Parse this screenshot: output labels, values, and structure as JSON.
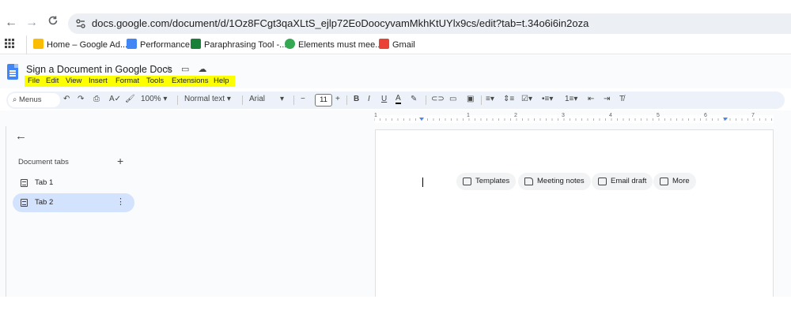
{
  "browser": {
    "url": "docs.google.com/document/d/1Oz8FCgt3qaXLtS_ejlp72EoDoocyvamMkhKtUYlx9cs/edit?tab=t.34o6i6in2oza",
    "back_icon": "←",
    "forward_icon": "→",
    "reload_icon": "C",
    "bookmarks": [
      {
        "label": "Home – Google Ad...",
        "color": "#fbbc04"
      },
      {
        "label": "Performance",
        "color": "#4285f4"
      },
      {
        "label": "Paraphrasing Tool -...",
        "color": "#188038"
      },
      {
        "label": "Elements must mee...",
        "color": "#34a853"
      },
      {
        "label": "Gmail",
        "color": "#ea4335"
      }
    ]
  },
  "doc": {
    "title": "Sign a Document in Google Docs",
    "menu": [
      "File",
      "Edit",
      "View",
      "Insert",
      "Format",
      "Tools",
      "Extensions",
      "Help"
    ],
    "highlight_color": "#fbff00"
  },
  "toolbar": {
    "menus_label": "Menus",
    "zoom": "100%",
    "style": "Normal text",
    "font": "Arial",
    "font_size": "11",
    "minus": "−",
    "plus": "+",
    "bold": "B",
    "italic": "I",
    "underline": "U",
    "text_color": "A"
  },
  "ruler_numbers": [
    "1",
    "1",
    "2",
    "3",
    "4",
    "5",
    "6",
    "7"
  ],
  "sidebar": {
    "back_icon": "←",
    "heading": "Document tabs",
    "add_icon": "+",
    "tabs": [
      {
        "label": "Tab 1",
        "active": false
      },
      {
        "label": "Tab 2",
        "active": true
      }
    ],
    "more_icon": "⋮"
  },
  "chips": [
    {
      "label": "Templates"
    },
    {
      "label": "Meeting notes"
    },
    {
      "label": "Email draft"
    },
    {
      "label": "More"
    }
  ]
}
